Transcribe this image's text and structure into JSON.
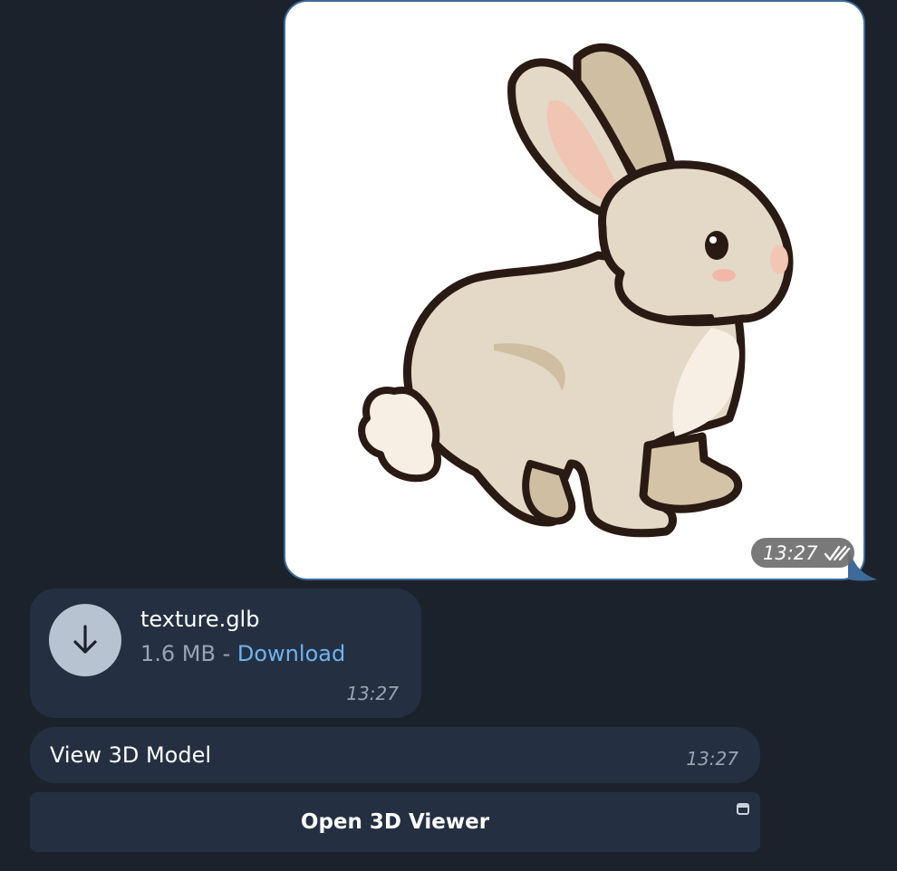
{
  "image_message": {
    "time": "13:27",
    "status_icon": "double-check-icon",
    "content_icon": "rabbit-sticker"
  },
  "file_message": {
    "file_name": "texture.glb",
    "file_size": "1.6 MB",
    "separator": " - ",
    "download_label": "Download",
    "time": "13:27"
  },
  "text_message": {
    "text": "View 3D Model",
    "time": "13:27"
  },
  "inline_button": {
    "label": "Open 3D Viewer"
  },
  "colors": {
    "background": "#1c222c",
    "bubble_incoming": "#243041",
    "bubble_outgoing_border": "#3d6a99",
    "link": "#6fb2ef",
    "secondary_text": "#9aa4b1"
  }
}
